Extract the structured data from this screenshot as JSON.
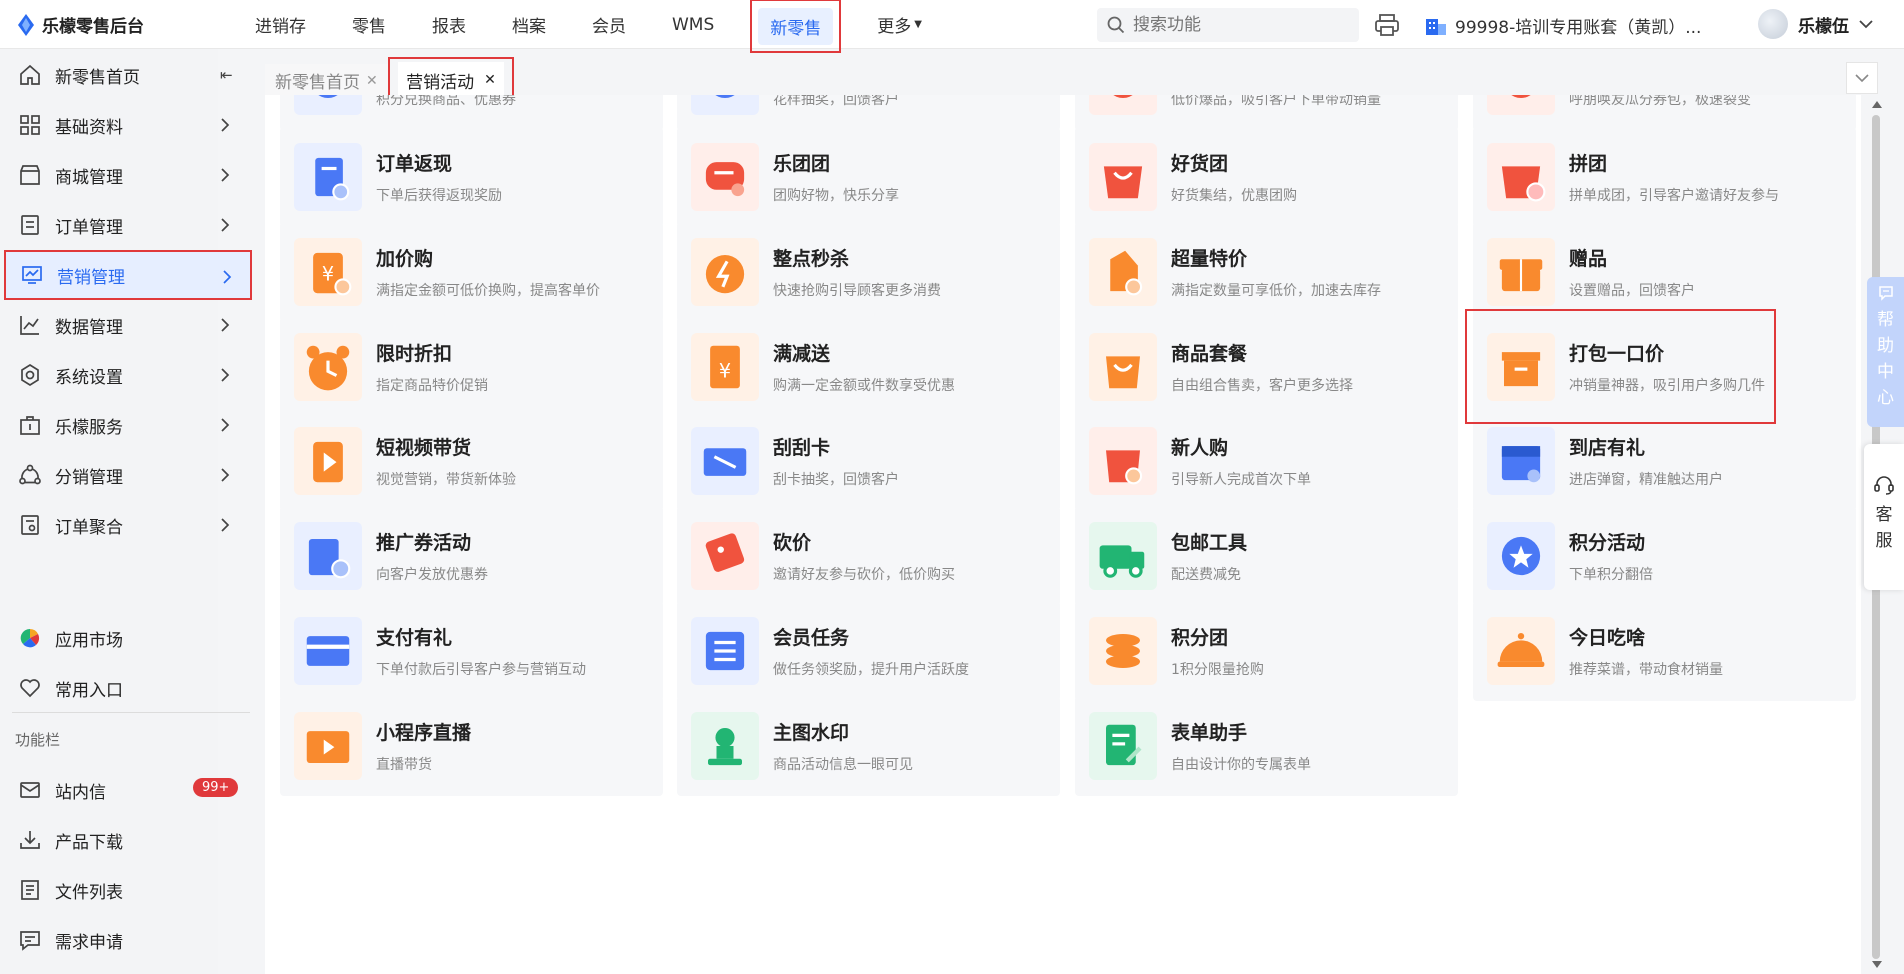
{
  "brand": {
    "title": "乐檬零售后台"
  },
  "top_nav": [
    {
      "label": "进销存"
    },
    {
      "label": "零售"
    },
    {
      "label": "报表"
    },
    {
      "label": "档案"
    },
    {
      "label": "会员"
    },
    {
      "label": "WMS"
    },
    {
      "label": "新零售",
      "active": true
    },
    {
      "label": "更多"
    }
  ],
  "search": {
    "placeholder": "搜索功能"
  },
  "account": {
    "name": "99998-培训专用账套（黄凯）..."
  },
  "user": {
    "name": "乐檬伍"
  },
  "sidebar": {
    "items": [
      {
        "label": "新零售首页",
        "icon": "home-icon"
      },
      {
        "label": "基础资料",
        "icon": "grid-icon"
      },
      {
        "label": "商城管理",
        "icon": "store-icon"
      },
      {
        "label": "订单管理",
        "icon": "order-icon"
      },
      {
        "label": "营销管理",
        "icon": "marketing-icon",
        "active": true
      },
      {
        "label": "数据管理",
        "icon": "chart-icon"
      },
      {
        "label": "系统设置",
        "icon": "settings-icon"
      },
      {
        "label": "乐檬服务",
        "icon": "service-icon"
      },
      {
        "label": "分销管理",
        "icon": "distribution-icon"
      },
      {
        "label": "订单聚合",
        "icon": "aggregate-icon"
      }
    ],
    "extra": [
      {
        "label": "应用市场",
        "icon": "app-market-icon"
      },
      {
        "label": "常用入口",
        "icon": "heart-icon"
      }
    ],
    "section_title": "功能栏",
    "tools": [
      {
        "label": "站内信",
        "icon": "mail-icon",
        "badge": "99+"
      },
      {
        "label": "产品下载",
        "icon": "download-icon"
      },
      {
        "label": "文件列表",
        "icon": "file-list-icon"
      },
      {
        "label": "需求申请",
        "icon": "request-icon"
      }
    ]
  },
  "tabs": [
    {
      "label": "新零售首页"
    },
    {
      "label": "营销活动",
      "active": true
    }
  ],
  "partial_row": [
    {
      "desc": "积分兑换商品、优惠券"
    },
    {
      "desc": "花样抽奖，回馈客户"
    },
    {
      "desc": "低价爆品，吸引客户下单带动销量"
    },
    {
      "desc": "呼朋唤友瓜分券包，极速裂变"
    }
  ],
  "cards": [
    {
      "title": "订单返现",
      "desc": "下单后获得返现奖励",
      "color": "#4a78f5"
    },
    {
      "title": "乐团团",
      "desc": "团购好物，快乐分享",
      "color": "#f0533e"
    },
    {
      "title": "好货团",
      "desc": "好货集结，优惠团购",
      "color": "#f0533e"
    },
    {
      "title": "拼团",
      "desc": "拼单成团，引导客户邀请好友参与",
      "color": "#f0533e"
    },
    {
      "title": "加价购",
      "desc": "满指定金额可低价换购，提高客单价",
      "color": "#f98a2e"
    },
    {
      "title": "整点秒杀",
      "desc": "快速抢购引导顾客更多消费",
      "color": "#f98a2e"
    },
    {
      "title": "超量特价",
      "desc": "满指定数量可享低价，加速去库存",
      "color": "#f98a2e"
    },
    {
      "title": "赠品",
      "desc": "设置赠品，回馈客户",
      "color": "#f98a2e"
    },
    {
      "title": "限时折扣",
      "desc": "指定商品特价促销",
      "color": "#f98a2e"
    },
    {
      "title": "满减送",
      "desc": "购满一定金额或件数享受优惠",
      "color": "#f98a2e"
    },
    {
      "title": "商品套餐",
      "desc": "自由组合售卖，客户更多选择",
      "color": "#f98a2e"
    },
    {
      "title": "打包一口价",
      "desc": "冲销量神器，吸引用户多购几件",
      "color": "#f98a2e"
    },
    {
      "title": "短视频带货",
      "desc": "视觉营销，带货新体验",
      "color": "#f98a2e"
    },
    {
      "title": "刮刮卡",
      "desc": "刮卡抽奖，回馈客户",
      "color": "#4a78f5"
    },
    {
      "title": "新人购",
      "desc": "引导新人完成首次下单",
      "color": "#f0533e"
    },
    {
      "title": "到店有礼",
      "desc": "进店弹窗，精准触达用户",
      "color": "#4a78f5"
    },
    {
      "title": "推广券活动",
      "desc": "向客户发放优惠券",
      "color": "#4a78f5"
    },
    {
      "title": "砍价",
      "desc": "邀请好友参与砍价，低价购买",
      "color": "#f0533e"
    },
    {
      "title": "包邮工具",
      "desc": "配送费减免",
      "color": "#22b573"
    },
    {
      "title": "积分活动",
      "desc": "下单积分翻倍",
      "color": "#4a78f5"
    },
    {
      "title": "支付有礼",
      "desc": "下单付款后引导客户参与营销互动",
      "color": "#4a78f5"
    },
    {
      "title": "会员任务",
      "desc": "做任务领奖励，提升用户活跃度",
      "color": "#4a78f5"
    },
    {
      "title": "积分团",
      "desc": "1积分限量抢购",
      "color": "#f98a2e"
    },
    {
      "title": "今日吃啥",
      "desc": "推荐菜谱，带动食材销量",
      "color": "#f98a2e"
    },
    {
      "title": "小程序直播",
      "desc": "直播带货",
      "color": "#f98a2e"
    },
    {
      "title": "主图水印",
      "desc": "商品活动信息一眼可见",
      "color": "#22b573"
    },
    {
      "title": "表单助手",
      "desc": "自由设计你的专属表单",
      "color": "#22b573"
    }
  ],
  "help": {
    "label_chars": [
      "帮",
      "助",
      "中",
      "心"
    ]
  },
  "kefu": {
    "label_chars": [
      "客",
      "服"
    ]
  }
}
